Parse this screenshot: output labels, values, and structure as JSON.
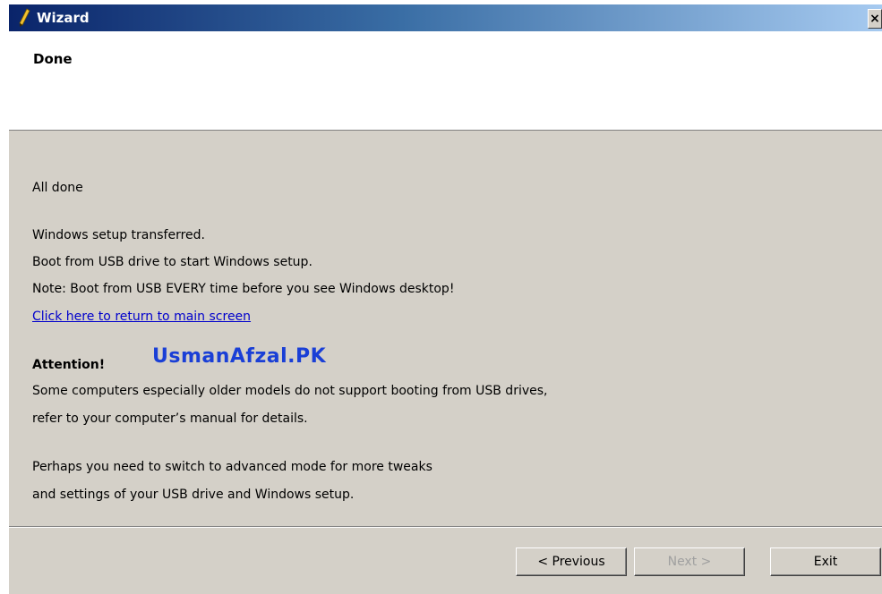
{
  "window": {
    "title": "Wizard",
    "close_glyph": "×",
    "icon": "pencil-icon"
  },
  "header": {
    "title": "Done"
  },
  "content": {
    "all_done": "All done",
    "line1": "Windows setup transferred.",
    "line2": "Boot from USB drive to start Windows setup.",
    "line3": "Note: Boot from USB EVERY time before you see Windows desktop!",
    "return_link": "Click here to return to main screen",
    "attention": "Attention!",
    "watermark": "UsmanAfzal.PK",
    "attention_line1": "Some computers especially older models do not support booting from USB drives,",
    "attention_line2": "refer to your computer’s manual for details.",
    "advanced_line1": "Perhaps you need to switch to advanced mode for more tweaks",
    "advanced_line2": "and settings of your USB drive and Windows setup."
  },
  "footer": {
    "previous_label": "< Previous",
    "next_label": "Next >",
    "exit_label": "Exit"
  },
  "colors": {
    "titlebar_start": "#0a246a",
    "titlebar_end": "#a6caf0",
    "panel": "#d4d0c8",
    "link": "#0000cc",
    "watermark": "#1a3fd6"
  }
}
